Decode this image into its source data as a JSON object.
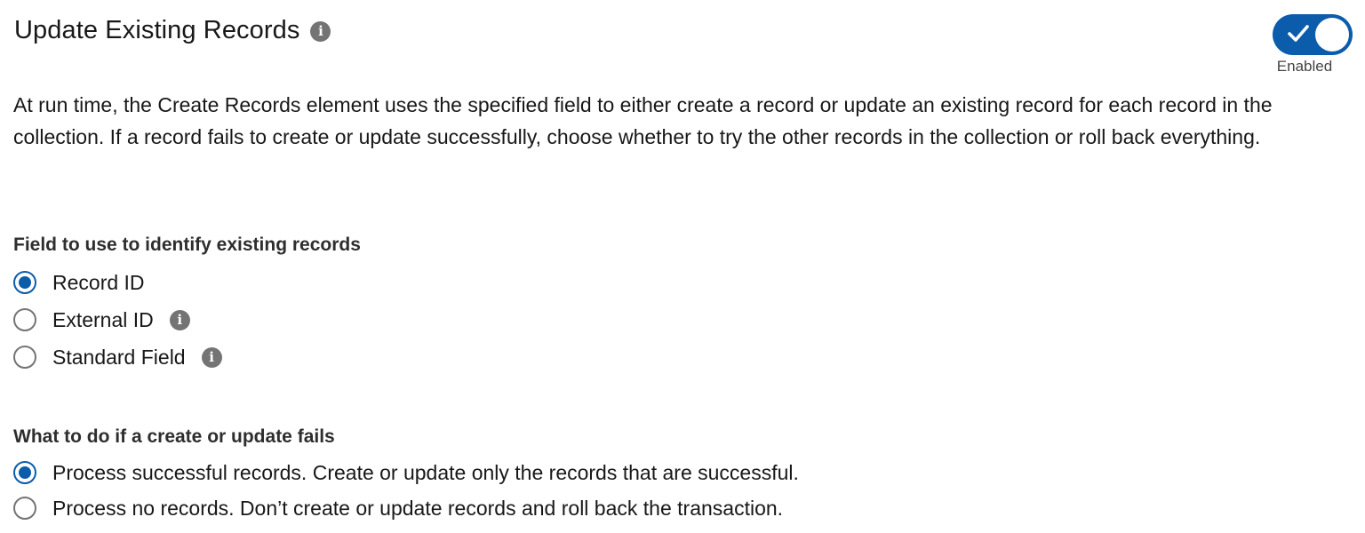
{
  "header": {
    "title": "Update Existing Records",
    "info_icon": "info-icon",
    "toggle": {
      "enabled": true,
      "status_label": "Enabled",
      "icon": "check-icon"
    }
  },
  "description": "At run time, the Create Records element uses the specified field to either create a record or update an existing record for each record in the collection. If a record fails to create or update successfully, choose whether to try the other records in the collection or roll back everything.",
  "identify_field": {
    "label": "Field to use to identify existing records",
    "options": [
      {
        "label": "Record ID",
        "selected": true,
        "has_info": false
      },
      {
        "label": "External ID",
        "selected": false,
        "has_info": true
      },
      {
        "label": "Standard Field",
        "selected": false,
        "has_info": true
      }
    ]
  },
  "failure_behavior": {
    "label": "What to do if a create or update fails",
    "options": [
      {
        "label": "Process successful records. Create or update only the records that are successful.",
        "selected": true
      },
      {
        "label": "Process no records. Don’t create or update records and roll back the transaction.",
        "selected": false
      }
    ]
  },
  "colors": {
    "accent": "#0b5cab",
    "icon_gray": "#747474",
    "text": "#181818"
  }
}
